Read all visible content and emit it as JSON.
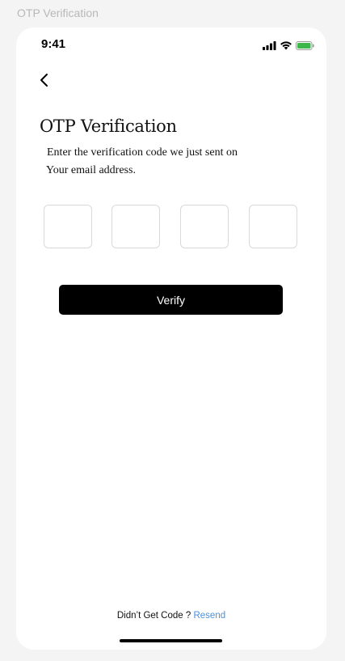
{
  "frame_label": "OTP Verification",
  "status_bar": {
    "time": "9:41",
    "icons": [
      "cellular-signal-icon",
      "wifi-icon",
      "battery-icon"
    ],
    "battery_color": "#3db64a"
  },
  "header": {
    "back_icon": "chevron-left-icon"
  },
  "main": {
    "title": "OTP Verification",
    "subtitle_line1": "Enter the verification code we just sent on",
    "subtitle_line2": "Your email address.",
    "otp_fields": [
      {
        "value": ""
      },
      {
        "value": ""
      },
      {
        "value": ""
      },
      {
        "value": ""
      }
    ],
    "verify_label": "Verify"
  },
  "footer": {
    "prompt": "Didn’t Get Code ?",
    "resend_label": "Resend",
    "accent_color": "#4a8fd8"
  }
}
